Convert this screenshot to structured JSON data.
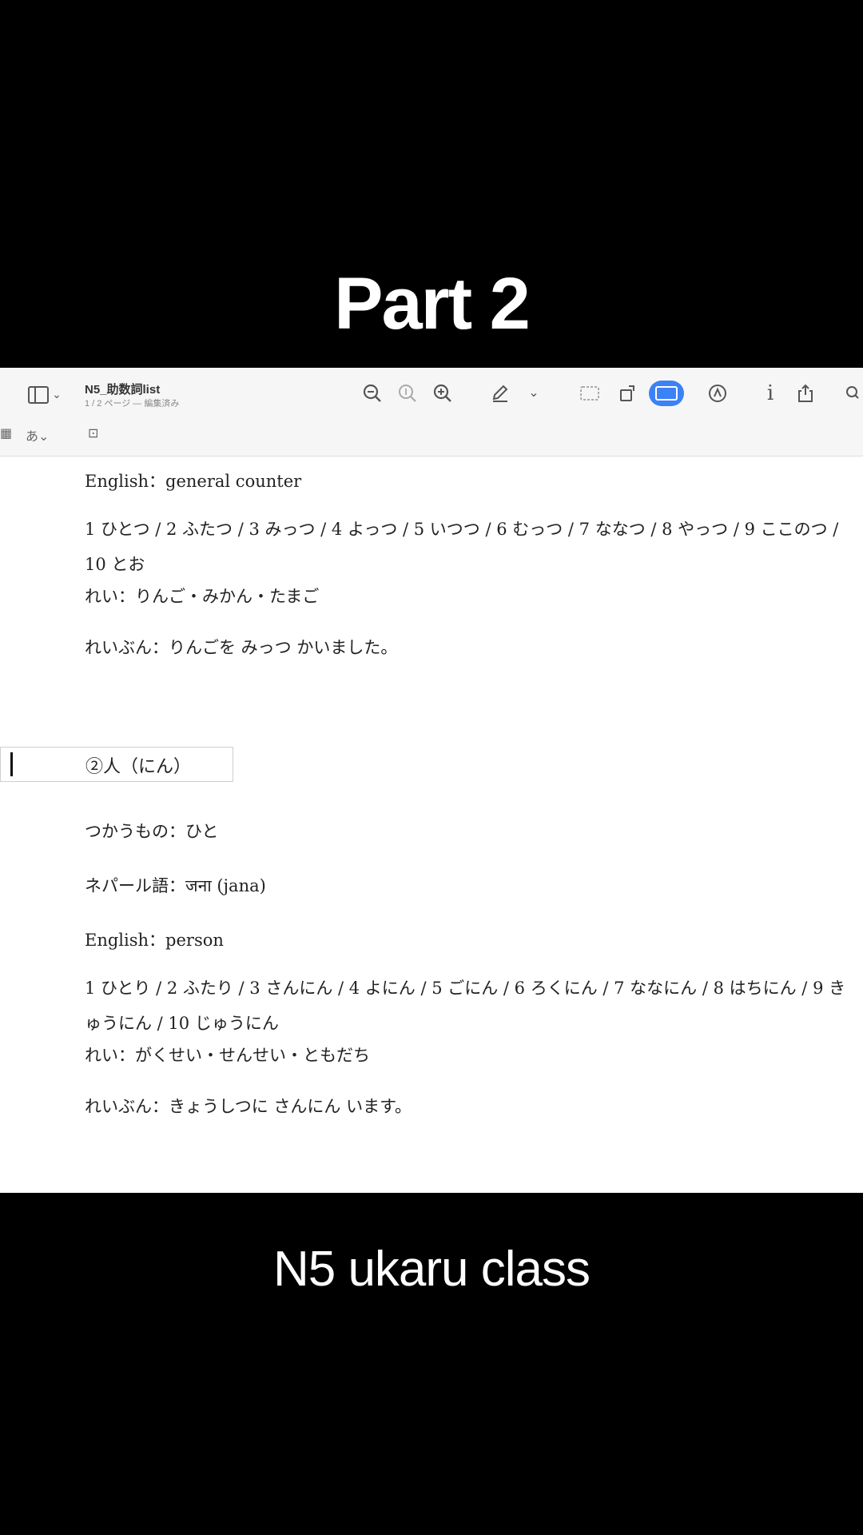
{
  "overlay": {
    "title": "Part 2",
    "caption": "N5 ukaru class"
  },
  "toolbar": {
    "doc_title": "N5_助数詞list",
    "doc_subtitle": "1 / 2 ページ — 編集済み",
    "icons": [
      "sidebar-icon",
      "zoom-out-icon",
      "actual-size-icon",
      "zoom-in-icon",
      "pen-icon",
      "chevron-down-icon",
      "selection-icon",
      "rotate-icon",
      "highlight-icon",
      "markup-icon",
      "info-icon",
      "share-icon",
      "search-icon"
    ]
  },
  "content": {
    "line1": "English：general counter",
    "line2": "1 ひとつ / 2 ふたつ / 3 みっつ / 4 よっつ / 5 いつつ / 6 むっつ / 7 ななつ / 8 やっつ / 9 ここのつ / 10 とお",
    "line3": "れい：りんご・みかん・たまご",
    "line4": "れいぶん：りんごを みっつ かいました。",
    "heading": "②人（にん）",
    "line5": "つかうもの：ひと",
    "line6": "ネパール語：जना (jana)",
    "line7": "English：person",
    "line8": "1 ひとり / 2 ふたり / 3 さんにん / 4 よにん / 5 ごにん / 6 ろくにん / 7 ななにん / 8 はちにん / 9 きゅうにん / 10 じゅうにん",
    "line9": "れい：がくせい・せんせい・ともだち",
    "line10": "れいぶん：きょうしつに さんにん います。"
  }
}
